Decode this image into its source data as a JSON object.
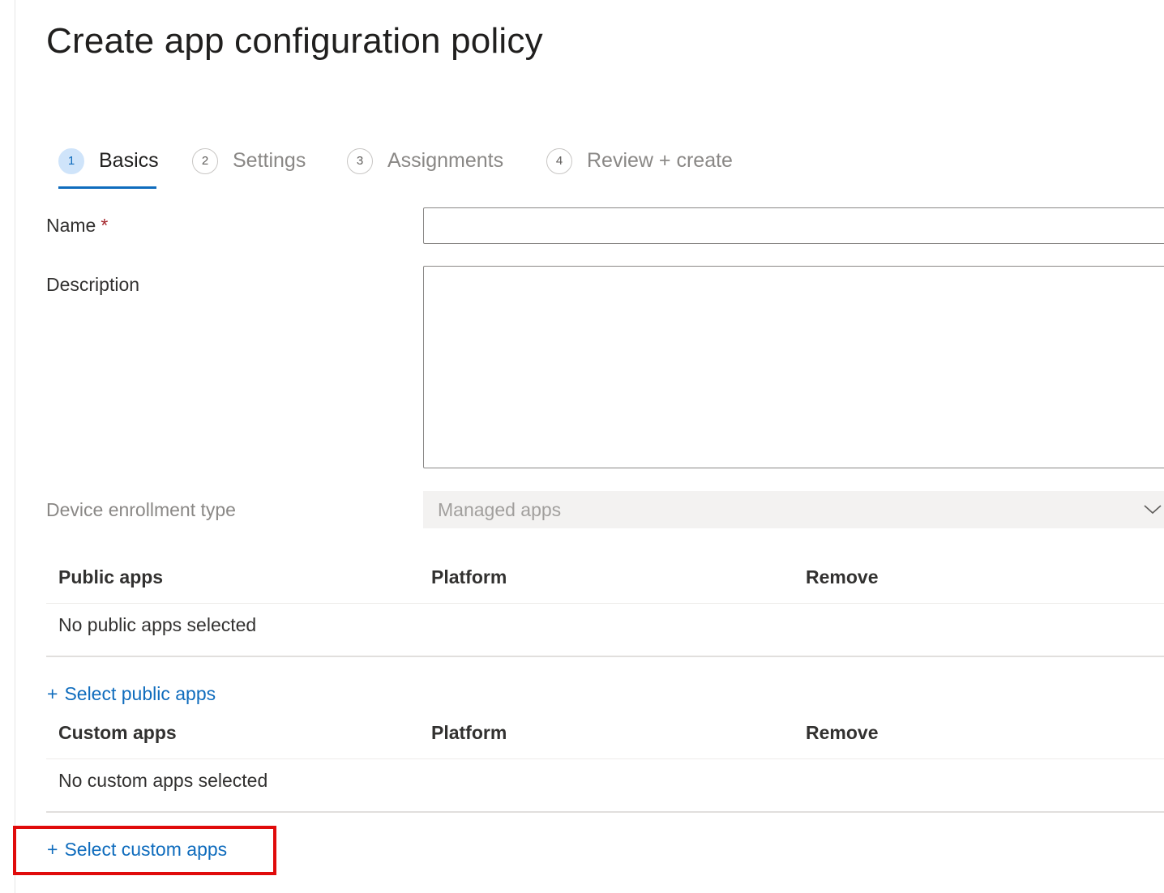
{
  "page": {
    "title": "Create app configuration policy"
  },
  "wizard": {
    "steps": [
      {
        "number": "1",
        "label": "Basics",
        "active": true
      },
      {
        "number": "2",
        "label": "Settings",
        "active": false
      },
      {
        "number": "3",
        "label": "Assignments",
        "active": false
      },
      {
        "number": "4",
        "label": "Review + create",
        "active": false
      }
    ]
  },
  "form": {
    "name_label": "Name",
    "required_marker": "*",
    "name_value": "",
    "description_label": "Description",
    "description_value": "",
    "enrollment_label": "Device enrollment type",
    "enrollment_value": "Managed apps"
  },
  "public_apps": {
    "columns": [
      "Public apps",
      "Platform",
      "Remove"
    ],
    "empty_text": "No public apps selected",
    "add_plus": "+",
    "add_label": "Select public apps"
  },
  "custom_apps": {
    "columns": [
      "Custom apps",
      "Platform",
      "Remove"
    ],
    "empty_text": "No custom apps selected",
    "add_plus": "+",
    "add_label": "Select custom apps"
  },
  "colors": {
    "accent": "#0f6cbd",
    "required": "#a4262c",
    "highlight_box": "#e00b0b",
    "active_step_bg": "#cfe4fa"
  },
  "icons": {
    "dropdown": "chevron-down-icon"
  }
}
